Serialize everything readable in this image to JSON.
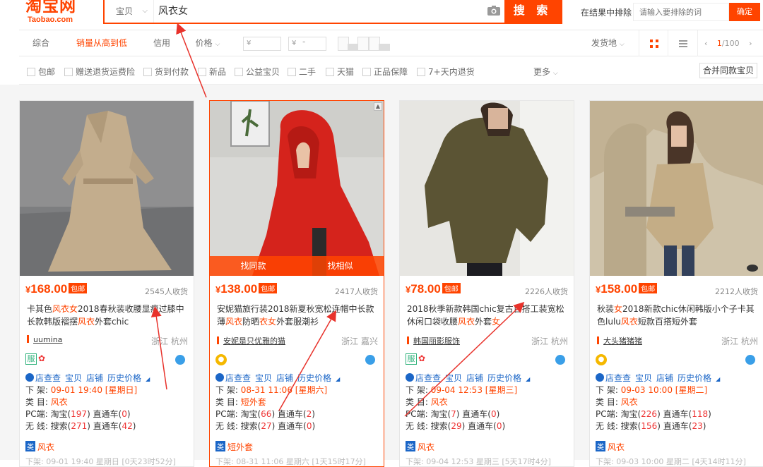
{
  "header": {
    "logo_cn": "淘宝网",
    "logo_en": "Taobao.com",
    "search_category": "宝贝",
    "search_query": "风衣女",
    "search_button": "搜 索",
    "exclude_label": "在结果中排除",
    "exclude_placeholder": "请输入要排除的词",
    "exclude_button": "确定"
  },
  "sort_bar": {
    "tabs": [
      "综合",
      "销量从高到低",
      "信用",
      "价格"
    ],
    "active_tab": "销量从高到低",
    "price_min_placeholder": "¥",
    "price_max_placeholder": "¥",
    "price_dash": "-",
    "ship_from": "发货地",
    "page_current": "1",
    "page_total": "/100"
  },
  "filter_bar": {
    "checkboxes": [
      "包邮",
      "赠送退货运费险",
      "货到付款",
      "新品",
      "公益宝贝",
      "二手",
      "天猫",
      "正品保障",
      "7+天内退货"
    ],
    "more": "更多",
    "merge_button": "合并同款宝贝"
  },
  "hover_actions": [
    "找同款",
    "找相似"
  ],
  "products": [
    {
      "price": "168.00",
      "currency": "¥",
      "baoyou": "包邮",
      "sales": "2545人收货",
      "title_html": [
        "卡其色",
        "风衣女",
        "2018春秋装收腰显瘦过膝中长款韩版褶摆",
        "风衣",
        "外套chic"
      ],
      "shop": "uumina",
      "location": "浙江 杭州",
      "tools": [
        "店查查",
        "宝贝",
        "店铺",
        "历史价格"
      ],
      "shelf_label": "下 架:",
      "shelf_date": "09-01 19:40",
      "shelf_day": "[星期日]",
      "category_label": "类 目:",
      "category": "风衣",
      "pc_line": [
        "PC端: 淘宝(",
        "197",
        ") 直通车(",
        "0",
        ")"
      ],
      "wx_line": [
        "无 线: 搜索(",
        "271",
        ") 直通车(",
        "42",
        ")"
      ],
      "cat_tag": "类",
      "cat_tag_text": "风衣",
      "cut_line": "下架: 09-01 19:40 星期日 [0天23时52分]"
    },
    {
      "price": "138.00",
      "currency": "¥",
      "baoyou": "包邮",
      "sales": "2417人收货",
      "title_html": [
        "安妮猫旅行装2018新夏秋宽松连帽中长款薄",
        "风衣",
        "防晒",
        "衣女",
        "外套服潮衫"
      ],
      "shop": "安妮是只优雅的猫",
      "location": "浙江 嘉兴",
      "tools": [
        "店查查",
        "宝贝",
        "店铺",
        "历史价格"
      ],
      "shelf_label": "下 架:",
      "shelf_date": "08-31 11:06",
      "shelf_day": "[星期六]",
      "category_label": "类 目:",
      "category": "短外套",
      "pc_line": [
        "PC端: 淘宝(",
        "66",
        ") 直通车(",
        "2",
        ")"
      ],
      "wx_line": [
        "无 线: 搜索(",
        "27",
        ") 直通车(",
        "0",
        ")"
      ],
      "cat_tag": "类",
      "cat_tag_text": "短外套",
      "cut_line": "下架: 08-31 11:06 星期六 [1天15时17分]"
    },
    {
      "price": "78.00",
      "currency": "¥",
      "baoyou": "包邮",
      "sales": "2226人收货",
      "title_html": [
        "2018秋季新款韩国chic复古百搭工装宽松休闲口袋收腰",
        "风衣",
        "外套",
        "女",
        ""
      ],
      "shop": "韩国丽影服饰",
      "location": "浙江 杭州",
      "tools": [
        "店查查",
        "宝贝",
        "店铺",
        "历史价格"
      ],
      "shelf_label": "下 架:",
      "shelf_date": "09-04 12:53",
      "shelf_day": "[星期三]",
      "category_label": "类 目:",
      "category": "风衣",
      "pc_line": [
        "PC端: 淘宝(",
        "7",
        ") 直通车(",
        "0",
        ")"
      ],
      "wx_line": [
        "无 线: 搜索(",
        "29",
        ") 直通车(",
        "0",
        ")"
      ],
      "cat_tag": "类",
      "cat_tag_text": "风衣",
      "cut_line": "下架: 09-04 12:53 星期三 [5天17时4分]"
    },
    {
      "price": "158.00",
      "currency": "¥",
      "baoyou": "包邮",
      "sales": "2212人收货",
      "title_html": [
        "秋装",
        "女",
        "2018新款chic休闲韩版小个子卡其色lulu",
        "风衣",
        "短款百搭短外套"
      ],
      "shop": "大头猪猪猪",
      "location": "浙江 杭州",
      "tools": [
        "店查查",
        "宝贝",
        "店铺",
        "历史价格"
      ],
      "shelf_label": "下 架:",
      "shelf_date": "09-03 10:00",
      "shelf_day": "[星期二]",
      "category_label": "类 目:",
      "category": "风衣",
      "pc_line": [
        "PC端: 淘宝(",
        "226",
        ") 直通车(",
        "118",
        ")"
      ],
      "wx_line": [
        "无 线: 搜索(",
        "156",
        ") 直通车(",
        "23",
        ")"
      ],
      "cat_tag": "类",
      "cat_tag_text": "风衣",
      "cut_line": "下架: 09-03 10:00 星期二 [4天14时11分]"
    }
  ],
  "colors": {
    "brand": "#ff4400",
    "link": "#1b66c7",
    "annotation_arrow": "#e8322b"
  }
}
